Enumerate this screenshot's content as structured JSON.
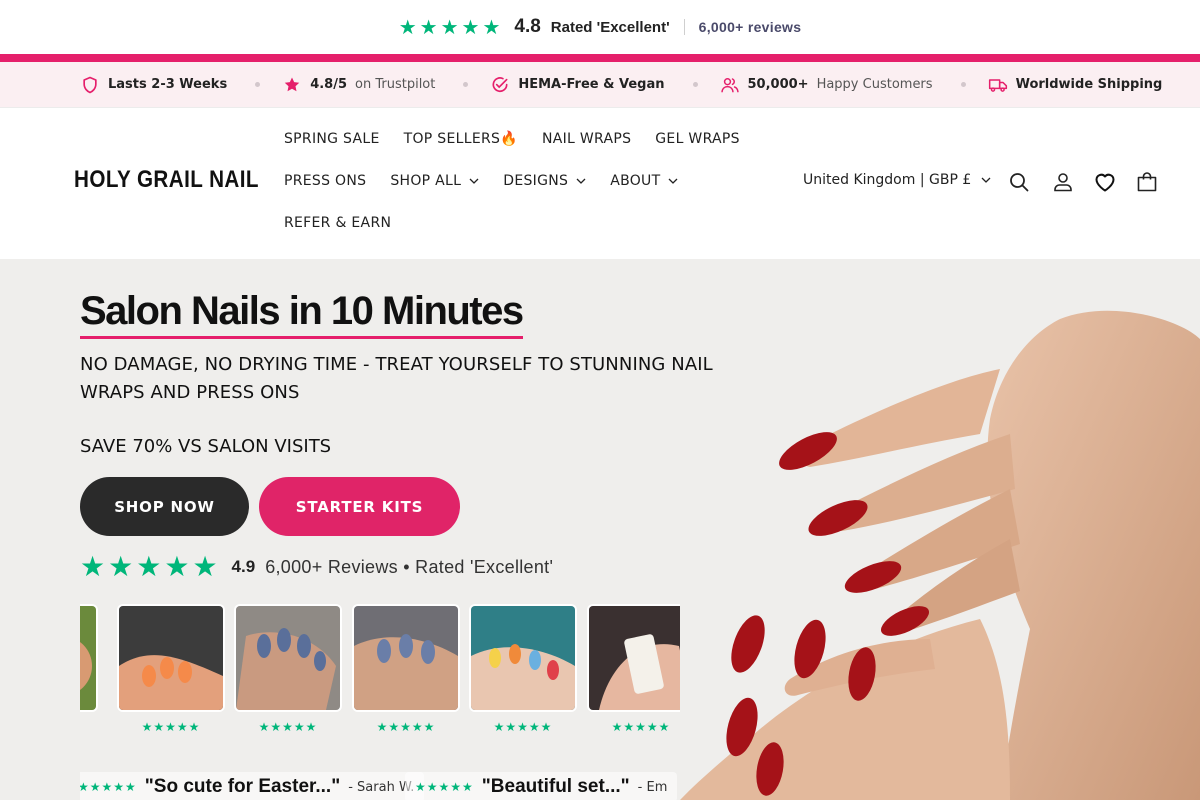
{
  "rating_bar": {
    "score": "4.8",
    "rated": "Rated 'Excellent'",
    "reviews": "6,000+ reviews",
    "star_color": "#00b67a"
  },
  "usp": [
    {
      "icon": "shield-icon",
      "bold": "Lasts 2-3 Weeks",
      "light": ""
    },
    {
      "icon": "star-icon",
      "bold": "4.8/5",
      "light": "on Trustpilot"
    },
    {
      "icon": "check-circle-icon",
      "bold": "HEMA-Free & Vegan",
      "light": ""
    },
    {
      "icon": "users-icon",
      "bold": "50,000+",
      "light": "Happy Customers"
    },
    {
      "icon": "truck-icon",
      "bold": "Worldwide Shipping",
      "light": ""
    }
  ],
  "header": {
    "logo": "HOLY GRAIL NAIL",
    "nav_row1": [
      "SPRING SALE",
      "TOP SELLERS🔥",
      "NAIL WRAPS",
      "GEL WRAPS"
    ],
    "nav_row2": [
      "PRESS ONS",
      "SHOP ALL",
      "DESIGNS",
      "ABOUT"
    ],
    "nav_row3": [
      "REFER & EARN"
    ],
    "country": "United Kingdom | GBP £",
    "icons": [
      "search-icon",
      "account-icon",
      "wishlist-icon",
      "cart-icon"
    ]
  },
  "hero": {
    "headline": "Salon Nails in 10 Minutes",
    "subline": "NO DAMAGE, NO DRYING TIME - TREAT YOURSELF TO STUNNING NAIL WRAPS AND PRESS ONS",
    "save": "SAVE 70% VS SALON VISITS",
    "btn_shop": "SHOP NOW",
    "btn_kits": "STARTER KITS",
    "rating_score": "4.9",
    "rating_text": "6,000+ Reviews • Rated 'Excellent'",
    "accent": "#e51f6b",
    "thumb_stars": "★★★★★",
    "quotes": [
      {
        "stars": "★★★★★",
        "text": "\"So cute for Easter...\"",
        "author": "- Sarah W."
      },
      {
        "stars": "★★★★★",
        "text": "\"Beautiful set...\"",
        "author": "- Em"
      }
    ]
  }
}
